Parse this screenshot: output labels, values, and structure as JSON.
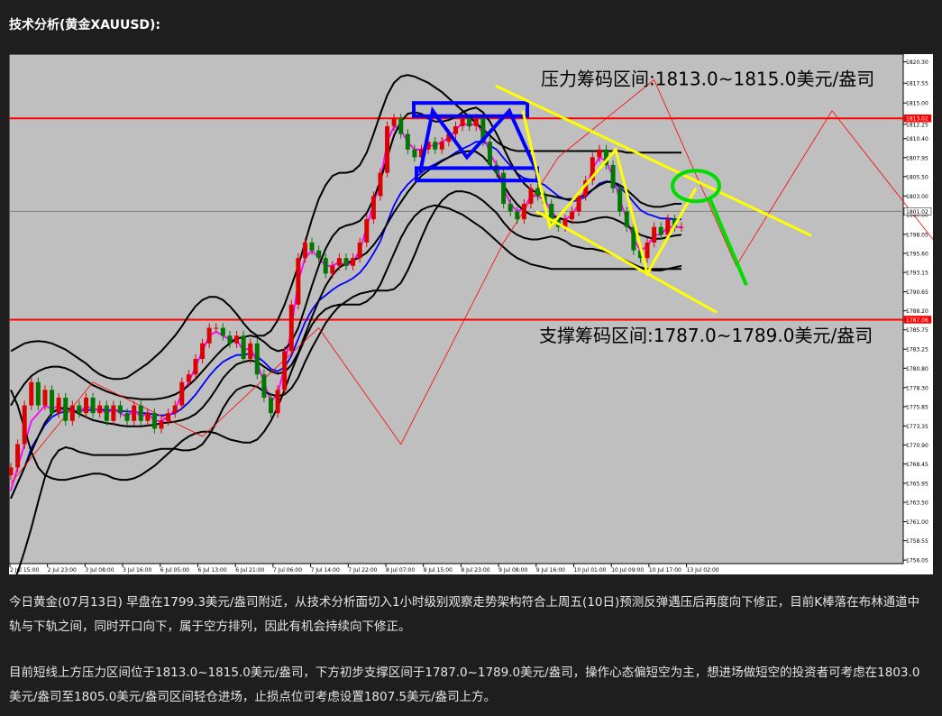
{
  "heading": "技术分析(黄金XAUUSD):",
  "paragraphs": [
    "今日黄金(07月13日) 早盘在1799.3美元/盎司附近，从技术分析面切入1小时级别观察走势架构符合上周五(10日)预测反弹遇压后再度向下修正，目前K棒落在布林通道中轨与下轨之间，同时开口向下，属于空方排列，因此有机会持续向下修正。",
    "目前短线上方压力区间位于1813.0~1815.0美元/盎司，下方初步支撑区间于1787.0~1789.0美元/盎司，操作心态偏短空为主，想进场做短空的投资者可考虑在1803.0美元/盎司至1805.0美元/盎司区间轻仓进场，止损点位可考虑设置1807.5美元/盎司上方。"
  ],
  "chart_data": {
    "type": "line",
    "instrument": "XAUUSD",
    "timeframe": "H1",
    "ylim": [
      1755.6,
      1821.3
    ],
    "annotations": {
      "resistance_label": "压力筹码区间:1813.0~1815.0美元/盎司",
      "support_label": "支撑筹码区间:1787.0~1789.0美元/盎司"
    },
    "resistance_line": 1813.02,
    "support_line": 1787.06,
    "current_price": 1801.02,
    "resistance_price_tag": "1813.02",
    "support_price_tag": "1787.06",
    "current_price_tag": "1801.02",
    "y_ticks": [
      "1820.30",
      "1817.55",
      "1815.00",
      "1812.25",
      "1810.40",
      "1807.95",
      "1805.50",
      "1803.00",
      "1800.60",
      "1798.05",
      "1795.60",
      "1793.15",
      "1790.65",
      "1788.20",
      "1785.75",
      "1783.25",
      "1780.80",
      "1778.30",
      "1775.85",
      "1773.35",
      "1770.90",
      "1768.45",
      "1765.95",
      "1763.50",
      "1761.00",
      "1758.55",
      "1756.05"
    ],
    "x_ticks": [
      "2 Jul 15:00",
      "2 Jul 23:00",
      "3 Jul 08:00",
      "3 Jul 16:00",
      "6 Jul 05:00",
      "6 Jul 13:00",
      "6 Jul 21:00",
      "7 Jul 06:00",
      "7 Jul 14:00",
      "7 Jul 22:00",
      "8 Jul 07:00",
      "8 Jul 15:00",
      "8 Jul 23:00",
      "9 Jul 08:00",
      "9 Jul 16:00",
      "10 Jul 01:00",
      "10 Jul 09:00",
      "10 Jul 17:00",
      "13 Jul 02:00"
    ],
    "close": [
      1768,
      1771,
      1776,
      1779,
      1776,
      1778,
      1775,
      1777,
      1774,
      1776,
      1775,
      1777,
      1775,
      1776,
      1774,
      1776,
      1775,
      1774,
      1776,
      1774,
      1775,
      1773,
      1774,
      1775,
      1776,
      1779,
      1780,
      1782,
      1784,
      1786,
      1786,
      1785,
      1784,
      1785,
      1782,
      1784,
      1780,
      1777,
      1775,
      1778,
      1783,
      1789,
      1795,
      1797,
      1796,
      1795,
      1793,
      1794,
      1795,
      1794,
      1795,
      1797,
      1800,
      1803,
      1806,
      1812,
      1813,
      1811,
      1809,
      1808,
      1809,
      1810,
      1809,
      1810,
      1811,
      1812,
      1813,
      1812,
      1813,
      1810,
      1807,
      1806,
      1802,
      1801,
      1800,
      1802,
      1804,
      1803,
      1802,
      1800,
      1799,
      1800,
      1801,
      1803,
      1805,
      1808,
      1809,
      1807,
      1804,
      1801,
      1799,
      1796,
      1795,
      1797,
      1799,
      1798,
      1800,
      1799,
      1799
    ],
    "series": [
      {
        "color": "#0000ff",
        "values": [
          1764.0,
          1766.0,
          1768.0,
          1770.5,
          1772.0,
          1773.5,
          1774.5,
          1775.0,
          1775.2,
          1775.3,
          1775.3,
          1775.4,
          1775.4,
          1775.5,
          1775.4,
          1775.4,
          1775.3,
          1775.2,
          1775.2,
          1775.0,
          1775.0,
          1774.8,
          1774.7,
          1774.8,
          1775.0,
          1775.6,
          1776.4,
          1777.4,
          1778.6,
          1779.8,
          1780.8,
          1781.6,
          1782.1,
          1782.5,
          1782.5,
          1782.7,
          1782.3,
          1781.6,
          1780.7,
          1780.4,
          1780.9,
          1782.4,
          1784.6,
          1786.7,
          1788.3,
          1789.5,
          1790.2,
          1790.9,
          1791.5,
          1791.9,
          1792.4,
          1793.1,
          1794.2,
          1795.6,
          1797.2,
          1799.6,
          1801.8,
          1803.4,
          1804.5,
          1805.3,
          1806.0,
          1806.7,
          1807.1,
          1807.6,
          1808.0,
          1808.6,
          1809.1,
          1809.5,
          1810.0,
          1810.0,
          1809.5,
          1809.0,
          1807.9,
          1806.9,
          1805.9,
          1805.3,
          1805.1,
          1804.8,
          1804.4,
          1803.7,
          1803.0,
          1802.6,
          1802.3,
          1802.5,
          1802.9,
          1803.8,
          1804.6,
          1804.9,
          1804.8,
          1804.1,
          1803.3,
          1802.2,
          1801.2,
          1800.7,
          1800.4,
          1800.1,
          1800.1,
          1800.0,
          1800.0
        ]
      },
      {
        "color": "#ff00ff",
        "values": [
          1765.0,
          1768.0,
          1771.0,
          1774.0,
          1775.0,
          1776.0,
          1775.5,
          1776.0,
          1775.0,
          1775.5,
          1775.0,
          1776.0,
          1775.5,
          1775.5,
          1775.0,
          1775.5,
          1775.0,
          1774.5,
          1775.5,
          1774.5,
          1775.0,
          1774.0,
          1774.0,
          1774.5,
          1775.5,
          1777.5,
          1779.0,
          1781.0,
          1783.0,
          1785.0,
          1785.5,
          1785.0,
          1784.5,
          1784.5,
          1783.0,
          1783.5,
          1781.5,
          1779.0,
          1776.5,
          1777.5,
          1781.0,
          1786.0,
          1792.0,
          1795.0,
          1796.0,
          1795.0,
          1794.0,
          1794.0,
          1794.5,
          1794.0,
          1794.5,
          1796.0,
          1799.0,
          1802.0,
          1805.0,
          1810.0,
          1812.0,
          1811.5,
          1810.0,
          1809.0,
          1809.0,
          1809.5,
          1809.5,
          1810.0,
          1810.5,
          1811.5,
          1812.5,
          1812.0,
          1812.5,
          1811.0,
          1808.5,
          1807.0,
          1804.0,
          1802.0,
          1801.0,
          1801.5,
          1803.0,
          1803.0,
          1802.5,
          1801.0,
          1800.0,
          1800.0,
          1800.5,
          1802.0,
          1804.0,
          1806.5,
          1808.0,
          1807.5,
          1805.5,
          1802.5,
          1800.0,
          1797.5,
          1796.0,
          1796.5,
          1798.0,
          1798.0,
          1799.0,
          1799.0,
          1799.0
        ]
      },
      {
        "color": "#000000",
        "values": [
          1776.0,
          1777.5,
          1778.8,
          1779.8,
          1780.4,
          1780.8,
          1781.0,
          1781.0,
          1780.8,
          1780.4,
          1779.8,
          1779.2,
          1778.6,
          1778.2,
          1777.8,
          1777.5,
          1777.2,
          1777.0,
          1776.9,
          1776.8,
          1776.8,
          1776.8,
          1776.9,
          1777.1,
          1777.4,
          1777.9,
          1778.6,
          1779.4,
          1780.4,
          1781.4,
          1782.4,
          1783.3,
          1784.0,
          1784.6,
          1784.8,
          1785.0,
          1784.8,
          1784.2,
          1783.4,
          1783.0,
          1783.2,
          1784.2,
          1786.0,
          1788.6,
          1791.4,
          1794.0,
          1796.2,
          1797.8,
          1798.8,
          1799.2,
          1799.4,
          1799.8,
          1800.8,
          1802.6,
          1805.0,
          1808.0,
          1810.8,
          1812.6,
          1813.6,
          1813.8,
          1813.6,
          1813.0,
          1812.6,
          1812.6,
          1812.8,
          1813.2,
          1813.8,
          1814.2,
          1814.4,
          1813.8,
          1812.6,
          1811.0,
          1809.2,
          1807.4,
          1805.8,
          1804.6,
          1803.8,
          1803.4,
          1803.2,
          1803.0,
          1802.8,
          1802.6,
          1802.6,
          1802.8,
          1803.2,
          1803.8,
          1804.4,
          1804.8,
          1804.8,
          1804.4,
          1803.8,
          1803.0,
          1802.2,
          1801.8,
          1801.6,
          1801.6,
          1801.8,
          1802.0,
          1802.0
        ]
      },
      {
        "color": "#000000",
        "values": [
          1752.0,
          1754.5,
          1757.2,
          1760.2,
          1763.6,
          1766.8,
          1769.0,
          1770.2,
          1770.6,
          1770.4,
          1770.0,
          1769.8,
          1769.6,
          1769.6,
          1769.6,
          1769.6,
          1769.6,
          1769.6,
          1769.7,
          1769.8,
          1770.0,
          1770.2,
          1770.4,
          1770.4,
          1770.4,
          1770.2,
          1770.2,
          1770.4,
          1771.0,
          1772.2,
          1773.8,
          1775.6,
          1777.0,
          1778.0,
          1778.4,
          1778.6,
          1778.4,
          1777.8,
          1777.4,
          1777.2,
          1777.4,
          1778.2,
          1779.6,
          1781.6,
          1783.4,
          1785.0,
          1786.6,
          1787.8,
          1788.8,
          1789.4,
          1790.0,
          1790.4,
          1790.6,
          1790.8,
          1790.8,
          1790.8,
          1791.0,
          1791.8,
          1793.4,
          1795.4,
          1797.6,
          1799.6,
          1801.2,
          1802.4,
          1803.2,
          1803.6,
          1803.6,
          1803.4,
          1803.0,
          1802.4,
          1801.6,
          1800.8,
          1799.6,
          1798.6,
          1798.0,
          1797.6,
          1797.4,
          1797.4,
          1797.6,
          1797.8,
          1797.6,
          1797.2,
          1796.6,
          1796.4,
          1796.2,
          1796.2,
          1796.0,
          1795.8,
          1795.4,
          1795.0,
          1794.6,
          1794.2,
          1793.8,
          1793.6,
          1793.4,
          1793.4,
          1793.6,
          1793.8,
          1794.0
        ]
      },
      {
        "color": "#000000",
        "values": [
          1764.0,
          1766.0,
          1768.0,
          1770.0,
          1772.0,
          1773.8,
          1775.0,
          1775.6,
          1775.7,
          1775.4,
          1774.9,
          1774.5,
          1774.1,
          1773.9,
          1773.7,
          1773.6,
          1773.4,
          1773.3,
          1773.3,
          1773.3,
          1773.4,
          1773.5,
          1773.7,
          1773.8,
          1773.9,
          1774.1,
          1774.4,
          1774.9,
          1775.7,
          1776.8,
          1778.1,
          1779.5,
          1780.5,
          1781.3,
          1781.6,
          1781.8,
          1781.6,
          1781.0,
          1780.4,
          1780.1,
          1780.3,
          1781.2,
          1782.8,
          1785.1,
          1787.4,
          1789.5,
          1791.4,
          1792.8,
          1793.8,
          1794.3,
          1794.7,
          1795.1,
          1795.7,
          1796.7,
          1797.9,
          1799.4,
          1800.9,
          1802.2,
          1803.5,
          1804.6,
          1805.6,
          1806.3,
          1806.9,
          1807.5,
          1808.0,
          1808.4,
          1808.7,
          1808.8,
          1808.7,
          1808.1,
          1807.1,
          1805.9,
          1804.4,
          1803.0,
          1801.9,
          1801.1,
          1800.6,
          1800.4,
          1800.4,
          1800.4,
          1800.2,
          1799.9,
          1799.6,
          1799.6,
          1799.7,
          1800.0,
          1800.2,
          1800.3,
          1800.1,
          1799.7,
          1799.2,
          1798.6,
          1798.0,
          1797.7,
          1797.5,
          1797.5,
          1797.7,
          1797.9,
          1798.0
        ]
      },
      {
        "color": "#000000",
        "values": [
          1783.0,
          1783.5,
          1784.0,
          1784.2,
          1784.3,
          1784.2,
          1784.0,
          1783.6,
          1783.2,
          1782.6,
          1782.0,
          1781.4,
          1780.6,
          1780.0,
          1779.6,
          1779.4,
          1779.4,
          1779.6,
          1780.2,
          1780.8,
          1781.4,
          1782.2,
          1783.0,
          1784.0,
          1785.0,
          1786.2,
          1787.6,
          1788.8,
          1789.6,
          1790.0,
          1790.0,
          1789.6,
          1788.8,
          1787.8,
          1786.6,
          1785.6,
          1785.0,
          1785.0,
          1785.6,
          1787.0,
          1789.0,
          1791.4,
          1794.0,
          1797.0,
          1800.0,
          1802.6,
          1804.4,
          1805.6,
          1806.0,
          1806.0,
          1806.2,
          1807.0,
          1808.6,
          1811.0,
          1813.6,
          1816.0,
          1817.6,
          1818.4,
          1818.6,
          1818.4,
          1818.0,
          1817.6,
          1817.0,
          1816.4,
          1815.6,
          1814.8,
          1814.0,
          1813.2,
          1812.4,
          1811.6,
          1810.8,
          1810.0,
          1809.4,
          1809.0,
          1808.8,
          1808.8,
          1808.8,
          1808.8,
          1808.8,
          1808.8,
          1808.8,
          1808.8,
          1808.8,
          1808.8,
          1808.8,
          1808.8,
          1808.8,
          1808.8,
          1808.8,
          1808.8,
          1808.6,
          1808.6,
          1808.6,
          1808.6,
          1808.6,
          1808.6,
          1808.6,
          1808.6,
          1808.6
        ]
      },
      {
        "color": "#000000",
        "values": [
          1778.0,
          1776.0,
          1773.0,
          1770.0,
          1768.0,
          1767.0,
          1766.6,
          1766.4,
          1766.4,
          1766.6,
          1766.8,
          1767.0,
          1767.2,
          1767.2,
          1767.0,
          1766.6,
          1766.4,
          1766.4,
          1766.6,
          1767.0,
          1767.6,
          1768.2,
          1769.0,
          1769.8,
          1770.6,
          1771.4,
          1772.0,
          1772.4,
          1772.6,
          1772.6,
          1772.4,
          1772.0,
          1771.6,
          1771.4,
          1771.2,
          1771.2,
          1771.6,
          1772.6,
          1774.0,
          1775.8,
          1778.0,
          1780.4,
          1782.6,
          1784.6,
          1786.4,
          1787.6,
          1788.4,
          1788.8,
          1789.0,
          1789.0,
          1789.0,
          1789.0,
          1789.4,
          1790.2,
          1791.6,
          1793.6,
          1795.6,
          1797.6,
          1799.2,
          1800.4,
          1801.2,
          1801.6,
          1801.8,
          1801.6,
          1801.4,
          1801.0,
          1800.6,
          1800.0,
          1799.4,
          1798.8,
          1798.0,
          1797.2,
          1796.4,
          1795.6,
          1795.0,
          1794.6,
          1794.2,
          1794.0,
          1793.8,
          1793.6,
          1793.6,
          1793.6,
          1793.6,
          1793.6,
          1793.6,
          1793.6,
          1793.6,
          1793.6,
          1793.6,
          1793.6,
          1793.6,
          1793.6,
          1793.6,
          1793.6,
          1793.6,
          1793.6,
          1793.6,
          1793.6,
          1793.6
        ]
      }
    ]
  }
}
